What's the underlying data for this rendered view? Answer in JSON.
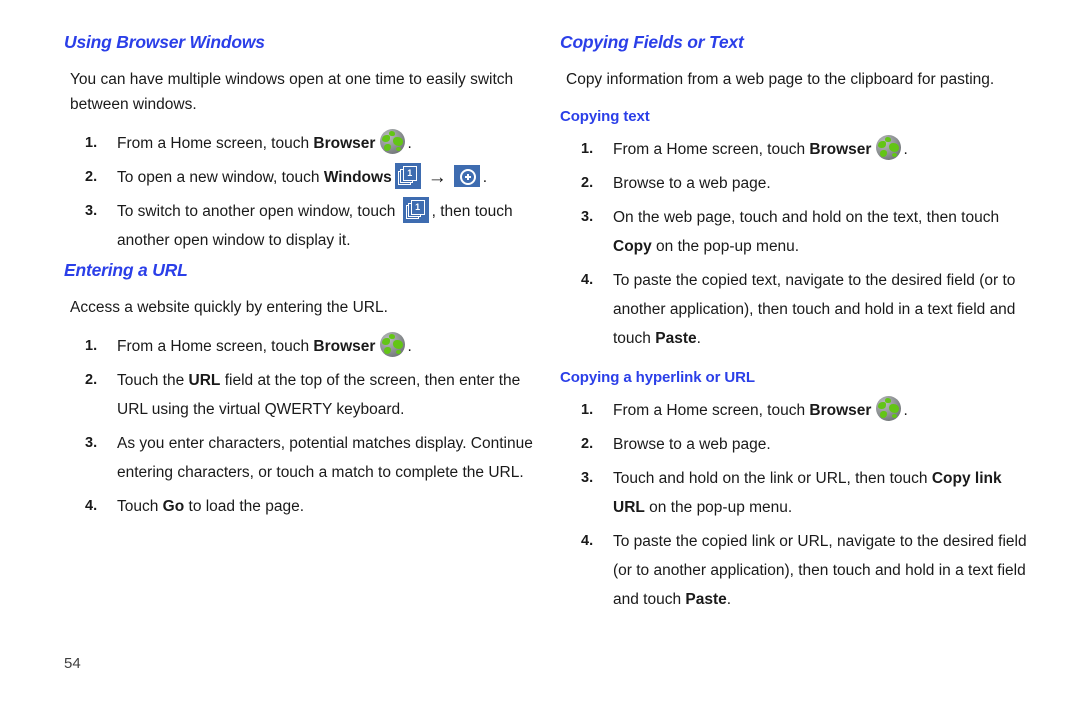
{
  "page": {
    "number": "54"
  },
  "icons": {
    "browser": "browser-globe-icon",
    "windows": "windows-stack-icon",
    "windows_badge": "1",
    "add": "add-window-icon",
    "arrow": "→"
  },
  "left_column": {
    "sections": [
      {
        "heading": "Using Browser Windows",
        "intro": "You can have multiple windows open at one time to easily switch between windows.",
        "steps": [
          {
            "num": "1.",
            "parts": [
              {
                "t": "From a Home screen, touch "
              },
              {
                "t": "Browser",
                "bold": true
              },
              {
                "t": " ",
                "icon": "browser"
              },
              {
                "t": "."
              }
            ]
          },
          {
            "num": "2.",
            "parts": [
              {
                "t": "To open a new window, touch "
              },
              {
                "t": "Windows",
                "bold": true
              },
              {
                "t": " ",
                "icon": "windows"
              },
              {
                "t": " ",
                "icon": "arrow"
              },
              {
                "t": " ",
                "icon": "add"
              },
              {
                "t": "."
              }
            ]
          },
          {
            "num": "3.",
            "parts": [
              {
                "t": "To switch to another open window, touch "
              },
              {
                "t": " ",
                "icon": "windows"
              },
              {
                "t": ", then touch another open window to display it."
              }
            ]
          }
        ]
      },
      {
        "heading": "Entering a URL",
        "intro": "Access a website quickly by entering the URL.",
        "steps": [
          {
            "num": "1.",
            "parts": [
              {
                "t": "From a Home screen, touch "
              },
              {
                "t": "Browser",
                "bold": true
              },
              {
                "t": " ",
                "icon": "browser"
              },
              {
                "t": "."
              }
            ]
          },
          {
            "num": "2.",
            "parts": [
              {
                "t": "Touch the "
              },
              {
                "t": "URL",
                "bold": true
              },
              {
                "t": " field at the top of the screen, then enter the URL using the virtual QWERTY keyboard."
              }
            ]
          },
          {
            "num": "3.",
            "parts": [
              {
                "t": "As you enter characters, potential matches display. Continue entering characters, or touch a match to complete the URL."
              }
            ]
          },
          {
            "num": "4.",
            "parts": [
              {
                "t": "Touch "
              },
              {
                "t": "Go",
                "bold": true
              },
              {
                "t": " to load the page."
              }
            ]
          }
        ]
      }
    ]
  },
  "right_column": {
    "sections": [
      {
        "heading": "Copying Fields or Text",
        "intro": "Copy information from a web page to the clipboard for pasting.",
        "subsections": [
          {
            "subheading": "Copying text",
            "steps": [
              {
                "num": "1.",
                "parts": [
                  {
                    "t": "From a Home screen, touch "
                  },
                  {
                    "t": "Browser",
                    "bold": true
                  },
                  {
                    "t": " ",
                    "icon": "browser"
                  },
                  {
                    "t": "."
                  }
                ]
              },
              {
                "num": "2.",
                "parts": [
                  {
                    "t": "Browse to a web page."
                  }
                ]
              },
              {
                "num": "3.",
                "parts": [
                  {
                    "t": "On the web page, touch and hold on the text, then touch "
                  },
                  {
                    "t": "Copy",
                    "bold": true
                  },
                  {
                    "t": " on the pop-up menu."
                  }
                ]
              },
              {
                "num": "4.",
                "parts": [
                  {
                    "t": "To paste the copied text, navigate to the desired field (or to another application), then touch and hold in a text field and touch "
                  },
                  {
                    "t": "Paste",
                    "bold": true
                  },
                  {
                    "t": "."
                  }
                ]
              }
            ]
          },
          {
            "subheading": "Copying a hyperlink or URL",
            "steps": [
              {
                "num": "1.",
                "parts": [
                  {
                    "t": "From a Home screen, touch "
                  },
                  {
                    "t": "Browser",
                    "bold": true
                  },
                  {
                    "t": " ",
                    "icon": "browser"
                  },
                  {
                    "t": "."
                  }
                ]
              },
              {
                "num": "2.",
                "parts": [
                  {
                    "t": "Browse to a web page."
                  }
                ]
              },
              {
                "num": "3.",
                "parts": [
                  {
                    "t": "Touch and hold on the link or URL, then touch "
                  },
                  {
                    "t": "Copy link URL",
                    "bold": true
                  },
                  {
                    "t": " on the pop-up menu."
                  }
                ]
              },
              {
                "num": "4.",
                "parts": [
                  {
                    "t": "To paste the copied link or URL, navigate to the desired field (or to another application), then touch and hold in a text field and touch "
                  },
                  {
                    "t": "Paste",
                    "bold": true
                  },
                  {
                    "t": "."
                  }
                ]
              }
            ]
          }
        ]
      }
    ]
  }
}
